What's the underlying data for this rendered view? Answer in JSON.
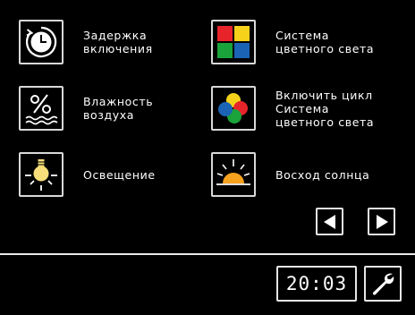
{
  "tiles": {
    "delay": {
      "label": "Задержка\nвключения",
      "icon": "timer-icon"
    },
    "color_system": {
      "label": "Система\nцветного света",
      "icon": "color-grid-icon"
    },
    "humidity": {
      "label": "Влажность\nвоздуха",
      "icon": "humidity-icon"
    },
    "color_cycle": {
      "label": "Включить цикл\nСистема\nцветного света",
      "icon": "color-cycle-icon"
    },
    "lighting": {
      "label": "Освещение",
      "icon": "light-bulb-icon"
    },
    "sunrise": {
      "label": "Восход солнца",
      "icon": "sunrise-icon"
    }
  },
  "nav": {
    "prev_icon": "triangle-left-icon",
    "next_icon": "triangle-right-icon"
  },
  "footer": {
    "time": "20:03",
    "settings_icon": "wrench-icon"
  },
  "colors": {
    "background": "#000000",
    "border": "#d8d8d8",
    "red": "#e8242b",
    "yellow": "#f6d21b",
    "green": "#1aa33b",
    "blue": "#1b63b5",
    "bulb": "#f8de7a"
  }
}
